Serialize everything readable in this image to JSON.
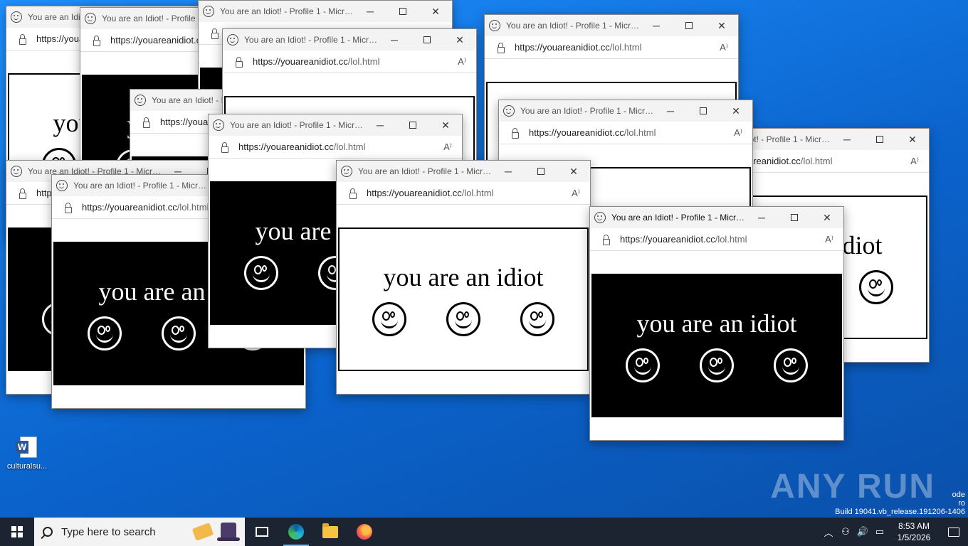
{
  "popup": {
    "title": "You are an Idiot! - Profile 1 - Micro...",
    "url_host": "https://youareanidiot.cc",
    "url_path": "/lol.html",
    "message": "you are an idiot",
    "minimize": "─",
    "close": "✕",
    "read_aloud": "A⁾"
  },
  "windows": [
    {
      "id": "w1",
      "theme": "light"
    },
    {
      "id": "w2",
      "theme": "dark"
    },
    {
      "id": "w3",
      "theme": "dark"
    },
    {
      "id": "w4",
      "theme": "light"
    },
    {
      "id": "w5",
      "theme": "dark"
    },
    {
      "id": "w6",
      "theme": "dark"
    },
    {
      "id": "w7",
      "theme": "light"
    },
    {
      "id": "w8",
      "theme": "light"
    },
    {
      "id": "w9",
      "theme": "dark"
    },
    {
      "id": "w10",
      "theme": "light"
    },
    {
      "id": "w11",
      "theme": "dark"
    },
    {
      "id": "w12",
      "theme": "light"
    },
    {
      "id": "w13",
      "theme": "dark",
      "active": true
    }
  ],
  "desktop": {
    "icon_label": "culturalsu...",
    "watermark": "ANY RUN",
    "build_text": "Build 19041.vb_release.191206-1406",
    "build_text_top": "ode",
    "build_text_mid": "ro"
  },
  "taskbar": {
    "search_placeholder": "Type here to search",
    "time": "8:53 AM",
    "date": "1/5/2026"
  }
}
